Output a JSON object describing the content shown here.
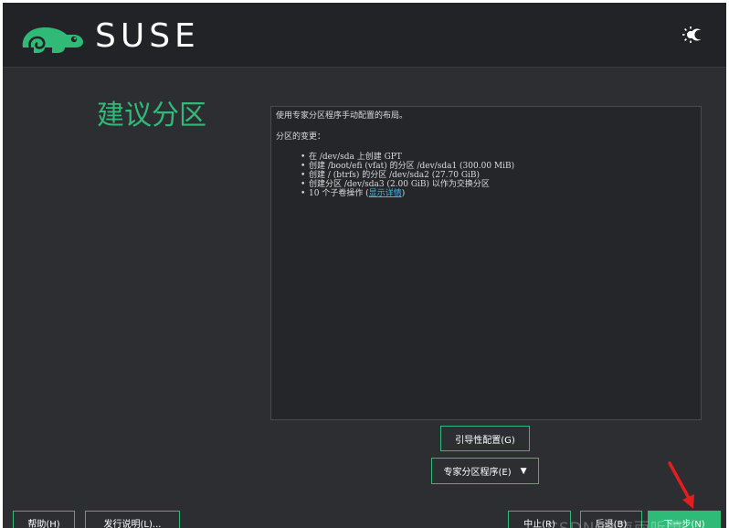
{
  "header": {
    "brand": "SUSE",
    "logo_icon": "suse-chameleon-icon",
    "theme_icon": "theme-toggle-icon"
  },
  "page": {
    "title": "建议分区"
  },
  "proposal": {
    "intro": "使用专家分区程序手动配置的布局。",
    "subhead": "分区的变更：",
    "changes": [
      "在 /dev/sda 上创建 GPT",
      "创建 /boot/efi (vfat) 的分区 /dev/sda1 (300.00 MiB)",
      "创建 / (btrfs) 的分区 /dev/sda2 (27.70 GiB)",
      "创建分区 /dev/sda3 (2.00 GiB) 以作为交换分区"
    ],
    "subvol_prefix": "10 个子卷操作 (",
    "subvol_link": "显示详情",
    "subvol_suffix": ")"
  },
  "buttons": {
    "guided": "引导性配置(G)",
    "expert": "专家分区程序(E)",
    "expert_caret": "▼",
    "help": "帮助(H)",
    "release_notes": "发行说明(L)...",
    "abort": "中止(R)",
    "back": "后退(B)",
    "next": "下一步(N)"
  },
  "colors": {
    "accent": "#30ba78",
    "link": "#3fb9e6",
    "annotation_arrow": "#e41e1e"
  },
  "watermark": "CSDN @夜雨听萧"
}
